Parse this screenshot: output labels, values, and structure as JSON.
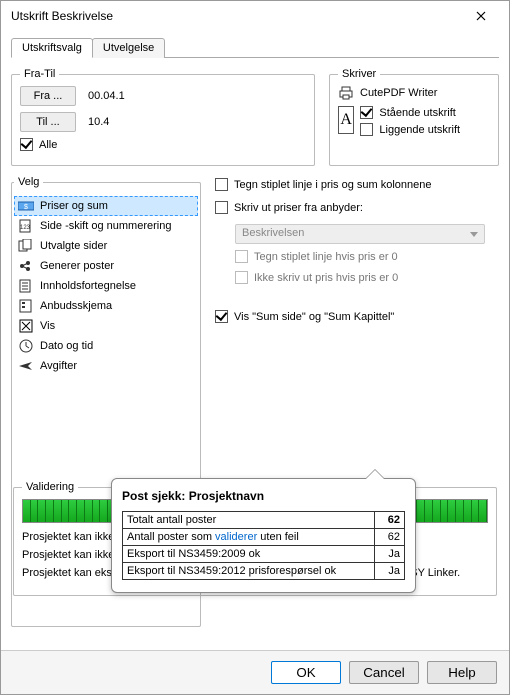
{
  "window": {
    "title": "Utskrift Beskrivelse"
  },
  "tabs": {
    "a": "Utskriftsvalg",
    "b": "Utvelgelse"
  },
  "fratil": {
    "legend": "Fra-Til",
    "fraBtn": "Fra ...",
    "fraVal": "00.04.1",
    "tilBtn": "Til ...",
    "tilVal": "10.4",
    "alle": "Alle"
  },
  "skriver": {
    "legend": "Skriver",
    "name": "CutePDF Writer",
    "staaende": "Stående utskrift",
    "liggende": "Liggende utskrift"
  },
  "velg": {
    "legend": "Velg",
    "items": [
      "Priser og sum",
      "Side -skift og nummerering",
      "Utvalgte sider",
      "Generer poster",
      "Innholdsfortegnelse",
      "Anbudsskjema",
      "Vis",
      "Dato og tid",
      "Avgifter"
    ]
  },
  "opts": {
    "stiplet": "Tegn stiplet linje i pris og sum kolonnene",
    "skriv": "Skriv ut priser fra anbyder:",
    "dropdown": "Beskrivelsen",
    "sub1": "Tegn stiplet linje hvis pris er 0",
    "sub2": "Ikke skriv ut pris hvis pris er 0",
    "vis": "Vis \"Sum side\" og \"Sum Kapittel\""
  },
  "callout": {
    "title": "Post sjekk: Prosjektnavn",
    "r1a": "Totalt antall poster",
    "r1b": "62",
    "r2a": "Antall poster som ",
    "r2link": "validerer",
    "r2a2": " uten feil",
    "r2b": "62",
    "r3a": "Eksport til NS3459:2009 ok",
    "r3b": "Ja",
    "r4a": "Eksport til NS3459:2012 prisforespørsel ok",
    "r4b": "Ja"
  },
  "valid": {
    "legend": "Validering",
    "n1": "Prosjektet kan ikke eksporteres til NS3459:2009 hvis det er brukt BE elementer",
    "n2": "Prosjektet kan ikke eksporteres til NS3459:2012 hvis post mangler mengde e.l.",
    "n3": "Prosjektet kan eksporteres til .GAB uten validering, men .GAB kan kun åpnes i ISY Linker."
  },
  "buttons": {
    "ok": "OK",
    "cancel": "Cancel",
    "help": "Help"
  }
}
